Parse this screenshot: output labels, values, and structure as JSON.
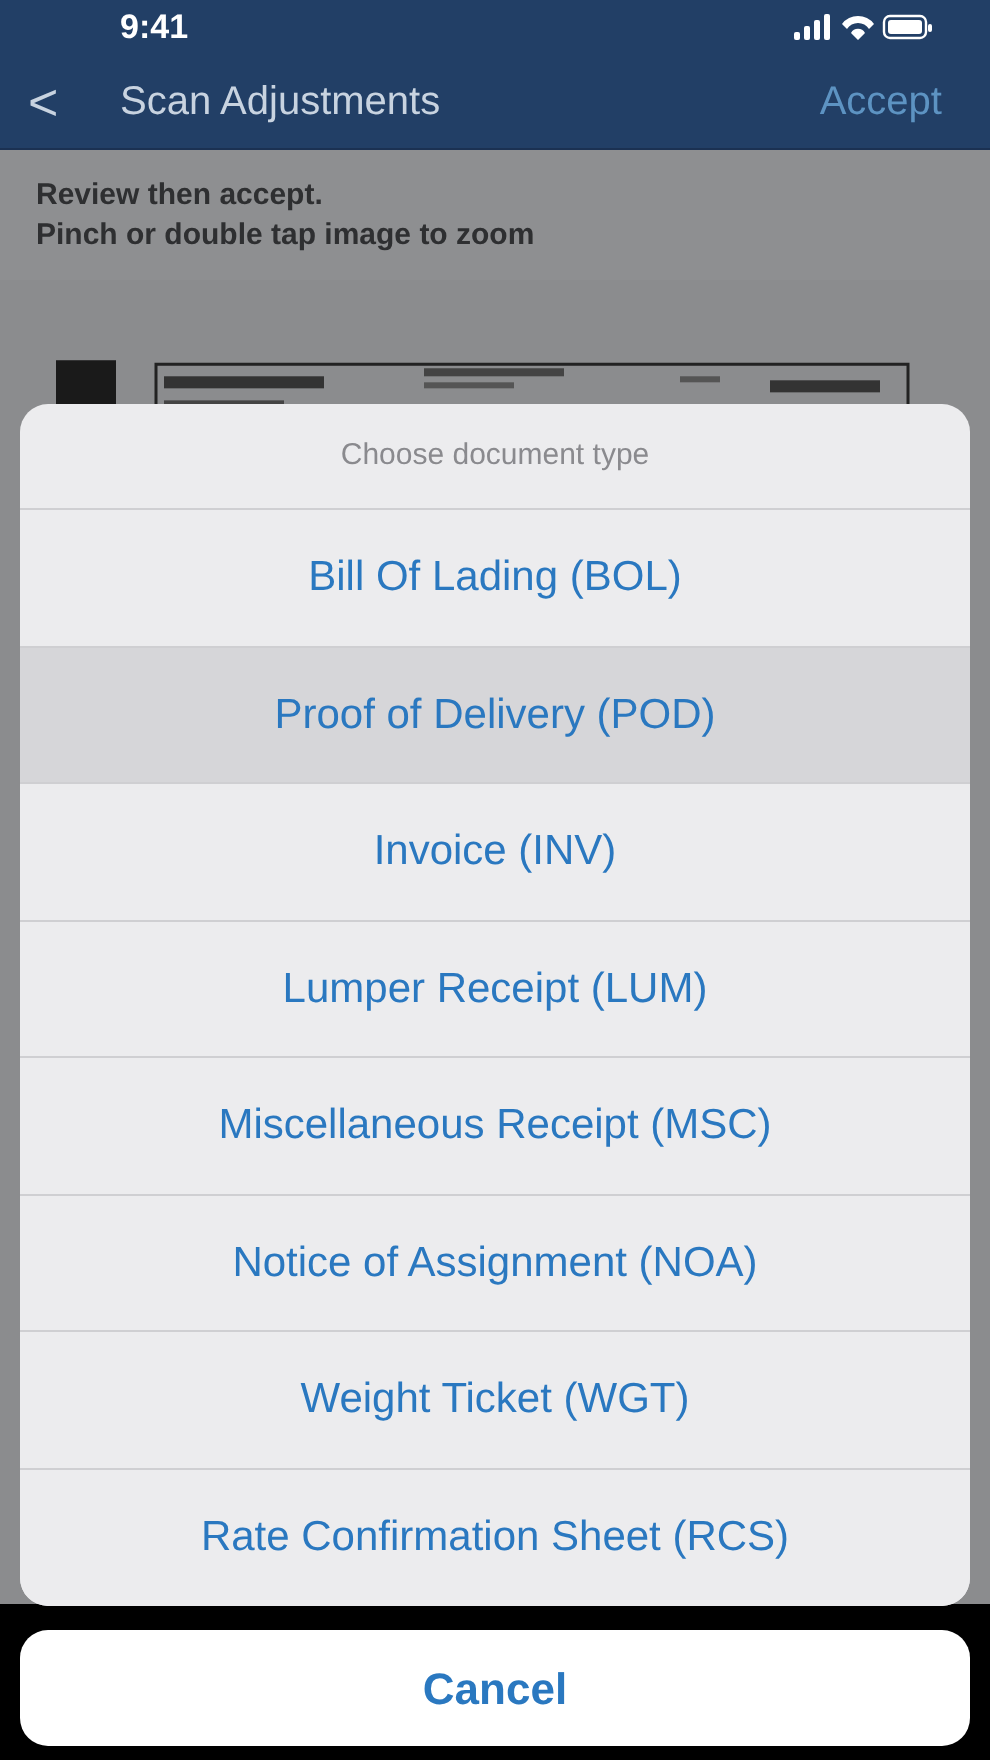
{
  "status_bar": {
    "time": "9:41"
  },
  "nav_bar": {
    "back": "<",
    "title": "Scan Adjustments",
    "action": "Accept"
  },
  "instructions": [
    "Review then accept.",
    "Pinch or double tap image to zoom"
  ],
  "action_sheet": {
    "title": "Choose document type",
    "options": [
      {
        "label": "Bill Of Lading (BOL)",
        "selected": false
      },
      {
        "label": "Proof of Delivery (POD)",
        "selected": true
      },
      {
        "label": "Invoice (INV)",
        "selected": false
      },
      {
        "label": "Lumper Receipt (LUM)",
        "selected": false
      },
      {
        "label": "Miscellaneous Receipt (MSC)",
        "selected": false
      },
      {
        "label": "Notice of Assignment (NOA)",
        "selected": false
      },
      {
        "label": "Weight Ticket (WGT)",
        "selected": false
      },
      {
        "label": "Rate Confirmation Sheet (RCS)",
        "selected": false
      }
    ],
    "cancel": "Cancel"
  }
}
